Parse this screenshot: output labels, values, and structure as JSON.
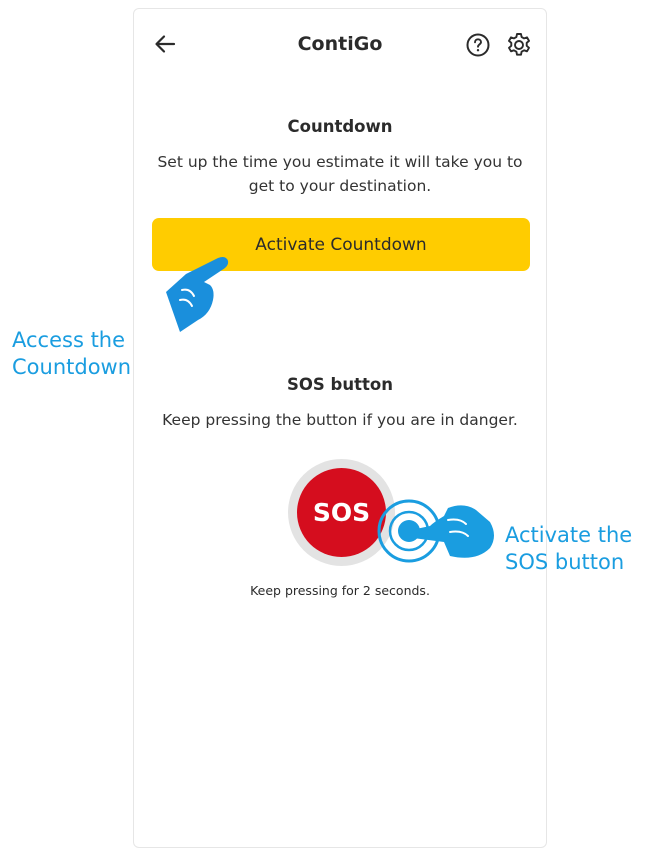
{
  "header": {
    "title": "ContiGo",
    "back_icon": "arrow-left-icon",
    "help_icon": "question-circle-icon",
    "settings_icon": "gear-icon"
  },
  "countdown": {
    "title": "Countdown",
    "description": "Set up the time you estimate it will take you to get to your destination.",
    "button_label": "Activate Countdown"
  },
  "sos": {
    "title": "SOS button",
    "description": "Keep pressing the button if you are in danger.",
    "button_label": "SOS",
    "hint": "Keep pressing for 2 seconds."
  },
  "annotations": {
    "countdown_line1": "Access the",
    "countdown_line2": "Countdown",
    "sos_line1": "Activate the",
    "sos_line2": "SOS button"
  },
  "colors": {
    "accent_yellow": "#ffcc00",
    "sos_red": "#d50d1e",
    "annotation_blue": "#1a9de0"
  }
}
